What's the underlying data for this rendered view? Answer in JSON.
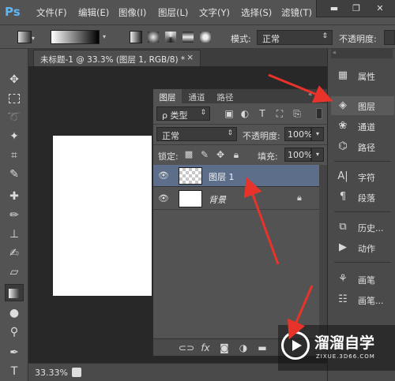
{
  "app": {
    "logo": "Ps"
  },
  "menu": [
    "文件(F)",
    "编辑(E)",
    "图像(I)",
    "图层(L)",
    "文字(Y)",
    "选择(S)",
    "滤镜(T)"
  ],
  "window_controls": {
    "minimize": "▬",
    "restore": "❐",
    "close": "✕"
  },
  "options": {
    "mode_label": "模式:",
    "mode_value": "正常",
    "opacity_label": "不透明度:"
  },
  "document_tab": {
    "title": "未标题-1 @ 33.3% (图层 1, RGB/8) *",
    "close": "×"
  },
  "status": {
    "zoom": "33.33%"
  },
  "dock": {
    "items": [
      {
        "label": "属性",
        "icon": "properties-icon"
      },
      {
        "label": "图层",
        "icon": "layers-icon"
      },
      {
        "label": "通道",
        "icon": "channels-icon"
      },
      {
        "label": "路径",
        "icon": "paths-icon"
      },
      {
        "label": "字符",
        "icon": "character-icon"
      },
      {
        "label": "段落",
        "icon": "paragraph-icon"
      },
      {
        "label": "历史...",
        "icon": "history-icon"
      },
      {
        "label": "动作",
        "icon": "actions-icon"
      },
      {
        "label": "画笔",
        "icon": "brush-icon"
      },
      {
        "label": "画笔...",
        "icon": "brush-presets-icon"
      }
    ]
  },
  "layers_panel": {
    "tabs": [
      "图层",
      "通道",
      "路径"
    ],
    "filter_label": "ρ 类型",
    "blend_mode": "正常",
    "opacity_label": "不透明度:",
    "opacity_value": "100%",
    "lock_label": "锁定:",
    "fill_label": "填充:",
    "fill_value": "100%",
    "layers": [
      {
        "name": "图层 1",
        "selected": true
      },
      {
        "name": "背景",
        "selected": false
      }
    ],
    "bottom_buttons": [
      "link-icon",
      "fx-icon",
      "mask-icon",
      "adjustment-icon",
      "folder-icon"
    ]
  },
  "watermark": {
    "title": "溜溜自学",
    "url": "ZIXUE.3D66.COM"
  },
  "colors": {
    "accent_selected": "#5d6e8a",
    "arrow": "#e8332b",
    "ps_blue": "#5fb6f5"
  }
}
